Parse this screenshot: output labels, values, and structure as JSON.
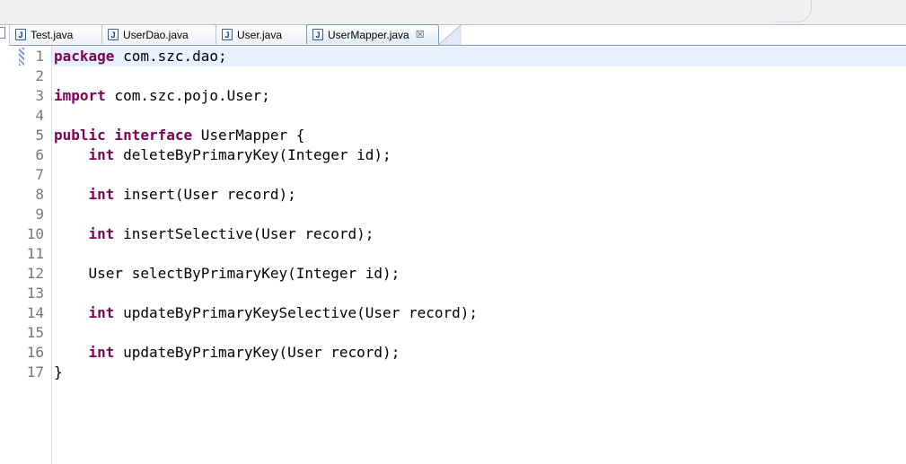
{
  "tabs": [
    {
      "label": "Test.java",
      "icon": "java-file-icon",
      "active": false
    },
    {
      "label": "UserDao.java",
      "icon": "java-file-icon",
      "active": false
    },
    {
      "label": "User.java",
      "icon": "java-file-icon",
      "active": false
    },
    {
      "label": "UserMapper.java",
      "icon": "java-file-icon",
      "active": true,
      "close_glyph": "☒"
    }
  ],
  "jicon_letter": "J",
  "line_numbers": [
    "1",
    "2",
    "3",
    "4",
    "5",
    "6",
    "7",
    "8",
    "9",
    "10",
    "11",
    "12",
    "13",
    "14",
    "15",
    "16",
    "17"
  ],
  "code": [
    {
      "kw": "package",
      "indent": "",
      "text": " com.szc.dao;"
    },
    {
      "kw": "",
      "indent": "",
      "text": ""
    },
    {
      "kw": "import",
      "indent": "",
      "text": " com.szc.pojo.User;"
    },
    {
      "kw": "",
      "indent": "",
      "text": ""
    },
    {
      "kw": "public interface",
      "indent": "",
      "text": " UserMapper {"
    },
    {
      "kw": "int",
      "indent": "    ",
      "text": " deleteByPrimaryKey(Integer id);"
    },
    {
      "kw": "",
      "indent": "",
      "text": ""
    },
    {
      "kw": "int",
      "indent": "    ",
      "text": " insert(User record);"
    },
    {
      "kw": "",
      "indent": "",
      "text": ""
    },
    {
      "kw": "int",
      "indent": "    ",
      "text": " insertSelective(User record);"
    },
    {
      "kw": "",
      "indent": "",
      "text": ""
    },
    {
      "kw": "",
      "indent": "    ",
      "text": "User selectByPrimaryKey(Integer id);"
    },
    {
      "kw": "",
      "indent": "",
      "text": ""
    },
    {
      "kw": "int",
      "indent": "    ",
      "text": " updateByPrimaryKeySelective(User record);"
    },
    {
      "kw": "",
      "indent": "",
      "text": ""
    },
    {
      "kw": "int",
      "indent": "    ",
      "text": " updateByPrimaryKey(User record);"
    },
    {
      "kw": "",
      "indent": "",
      "text": "}"
    }
  ],
  "colors": {
    "keyword": "#7f0055",
    "current_line": "#e8f2fe",
    "line_number": "#787878"
  }
}
